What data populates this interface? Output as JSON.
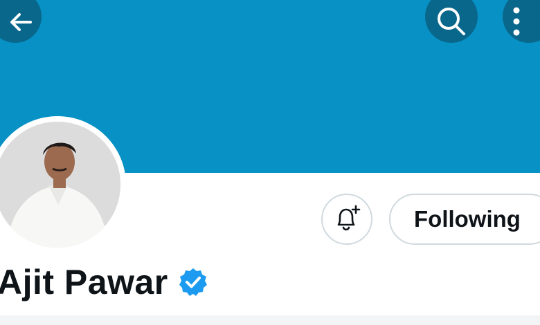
{
  "colors": {
    "banner": "#0791c4",
    "icon": "#ffffff",
    "verified": "#1d9bf0",
    "text": "#0f1419",
    "button_border": "#cfd9de"
  },
  "header": {
    "back_icon": "arrow-left-icon",
    "search_icon": "search-icon",
    "more_icon": "more-vertical-icon"
  },
  "profile": {
    "name": "Ajit Pawar",
    "verified_icon": "verified-badge-icon",
    "avatar": "profile-photo"
  },
  "actions": {
    "notify_icon": "bell-plus-icon",
    "follow_label": "Following"
  }
}
